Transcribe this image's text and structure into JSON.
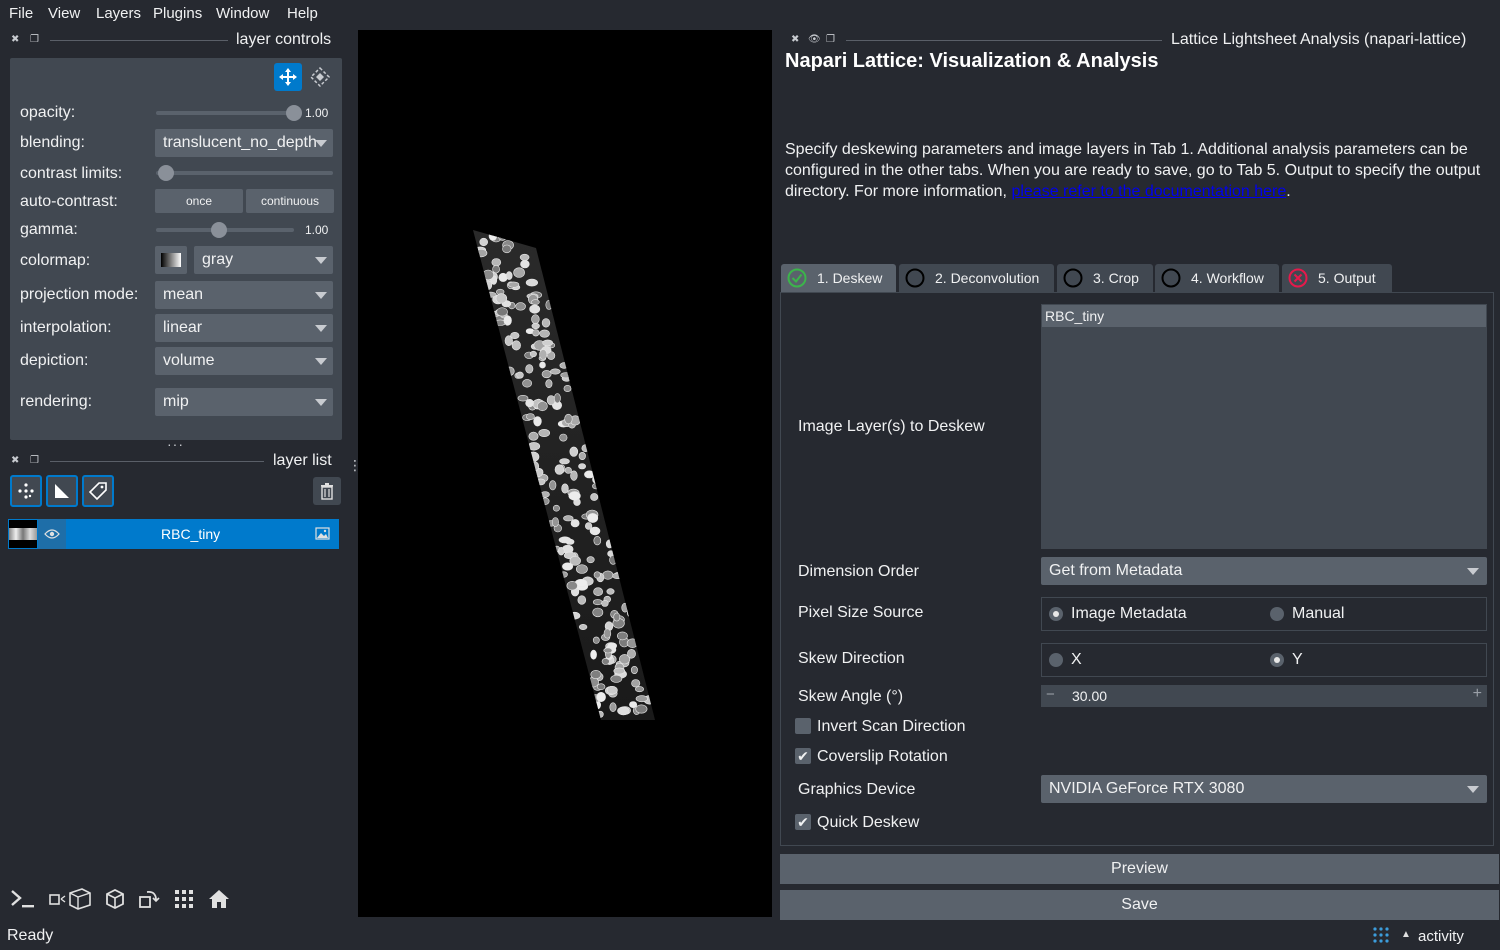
{
  "menubar": {
    "items": [
      "File",
      "View",
      "Layers",
      "Plugins",
      "Window",
      "Help"
    ]
  },
  "layer_controls": {
    "title": "layer controls",
    "opacity": {
      "label": "opacity:",
      "value": "1.00",
      "fraction": 1.0
    },
    "blending": {
      "label": "blending:",
      "value": "translucent_no_depth"
    },
    "contrast_limits": {
      "label": "contrast limits:"
    },
    "auto_contrast": {
      "label": "auto-contrast:",
      "once": "once",
      "continuous": "continuous"
    },
    "gamma": {
      "label": "gamma:",
      "value": "1.00",
      "fraction": 0.5
    },
    "colormap": {
      "label": "colormap:",
      "value": "gray"
    },
    "projection_mode": {
      "label": "projection mode:",
      "value": "mean"
    },
    "interpolation": {
      "label": "interpolation:",
      "value": "linear"
    },
    "depiction": {
      "label": "depiction:",
      "value": "volume"
    },
    "rendering": {
      "label": "rendering:",
      "value": "mip"
    }
  },
  "layer_list": {
    "title": "layer list",
    "layers": [
      {
        "name": "RBC_tiny"
      }
    ]
  },
  "status": {
    "text": "Ready",
    "activity": "activity"
  },
  "plugin": {
    "dock_title": "Lattice Lightsheet Analysis (napari-lattice)",
    "heading": "Napari Lattice: Visualization & Analysis",
    "description_1": "Specify deskewing parameters and image layers in Tab 1.  Additional analysis parameters can be configured in the other tabs.  When you are ready to save, go to Tab 5.  Output to specify the output directory.  For more information, ",
    "link_text": "please refer to the documentation here",
    "description_2": ".",
    "tabs": [
      {
        "label": "1. Deskew",
        "status": "ok"
      },
      {
        "label": "2. Deconvolution",
        "status": "none"
      },
      {
        "label": "3. Crop",
        "status": "none"
      },
      {
        "label": "4. Workflow",
        "status": "none"
      },
      {
        "label": "5. Output",
        "status": "error"
      }
    ],
    "image_layers_label": "Image Layer(s) to Deskew",
    "image_layers_items": [
      "RBC_tiny"
    ],
    "dimension_order": {
      "label": "Dimension Order",
      "value": "Get from Metadata"
    },
    "pixel_size_source": {
      "label": "Pixel Size Source",
      "option_1": "Image Metadata",
      "option_2": "Manual",
      "selected": "Image Metadata"
    },
    "skew_direction": {
      "label": "Skew Direction",
      "option_1": "X",
      "option_2": "Y",
      "selected": "Y"
    },
    "skew_angle": {
      "label": "Skew Angle (°)",
      "value": "30.00",
      "minus": "−",
      "plus": "+"
    },
    "invert_scan": {
      "label": "Invert Scan Direction",
      "checked": false
    },
    "coverslip_rotation": {
      "label": "Coverslip Rotation",
      "checked": true
    },
    "graphics_device": {
      "label": "Graphics Device",
      "value": "NVIDIA GeForce RTX 3080"
    },
    "quick_deskew": {
      "label": "Quick Deskew",
      "checked": true
    },
    "preview_label": "Preview",
    "save_label": "Save"
  },
  "colors": {
    "accent": "#007acc",
    "panel": "#414851",
    "background": "#262930",
    "ok": "#3cb44b",
    "error": "#e6194b"
  }
}
